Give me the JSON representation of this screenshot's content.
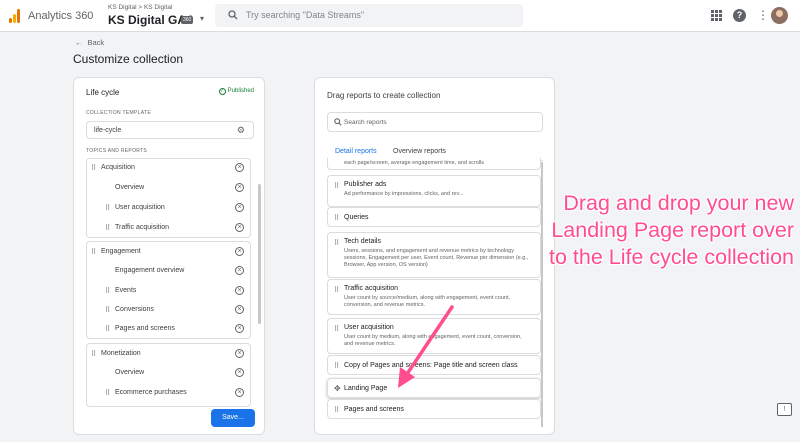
{
  "topbar": {
    "app_title": "Analytics 360",
    "account_path": "KS Digital > KS Digital",
    "property_name": "KS Digital GA4",
    "property_badge": "360",
    "search_placeholder": "Try searching \"Data Streams\"",
    "icons": [
      "apps-grid-icon",
      "help-icon",
      "more-vert-icon",
      "avatar"
    ]
  },
  "header": {
    "back_label": "Back",
    "title": "Customize collection"
  },
  "left_panel": {
    "title": "Life cycle",
    "status": "Published",
    "template_label": "COLLECTION TEMPLATE",
    "template_value": "life-cycle",
    "topics_label": "TOPICS AND REPORTS",
    "topics": [
      {
        "name": "Acquisition",
        "reports": [
          "Overview",
          "User acquisition",
          "Traffic acquisition"
        ]
      },
      {
        "name": "Engagement",
        "reports": [
          "Engagement overview",
          "Events",
          "Conversions",
          "Pages and screens"
        ]
      },
      {
        "name": "Monetization",
        "reports": [
          "Overview",
          "Ecommerce purchases"
        ]
      }
    ],
    "save_label": "Save..."
  },
  "right_panel": {
    "title": "Drag reports to create collection",
    "search_placeholder": "Search reports",
    "tabs": [
      "Detail reports",
      "Overview reports"
    ],
    "active_tab": "Detail reports",
    "cards": [
      {
        "title": "",
        "desc": "each page/screen, average engagement time, and scrolls"
      },
      {
        "title": "Publisher ads",
        "desc": "Ad performance by impressions, clicks, and rev..."
      },
      {
        "title": "Queries",
        "desc": ""
      },
      {
        "title": "Tech details",
        "desc": "Users, sessions, and engagement and revenue metrics by technology sessions, Engagement per user, Event count, Revenue per dimension (e.g., Browser, App version, OS version)"
      },
      {
        "title": "Traffic acquisition",
        "desc": "User count by source/medium, along with engagement, event count, conversion, and revenue metrics."
      },
      {
        "title": "User acquisition",
        "desc": "User count by medium, along with engagement, event count, conversion, and revenue metrics."
      },
      {
        "title": "Copy of Pages and screens: Page title and screen class",
        "desc": ""
      },
      {
        "title": "Landing Page",
        "desc": ""
      },
      {
        "title": "Pages and screens",
        "desc": ""
      }
    ]
  },
  "annotation": {
    "lines": [
      "Drag and drop your new",
      "Landing Page report over",
      "to the Life cycle collection"
    ],
    "color": "#ff4d8d"
  },
  "colors": {
    "accent": "#1a73e8",
    "published": "#188038"
  }
}
